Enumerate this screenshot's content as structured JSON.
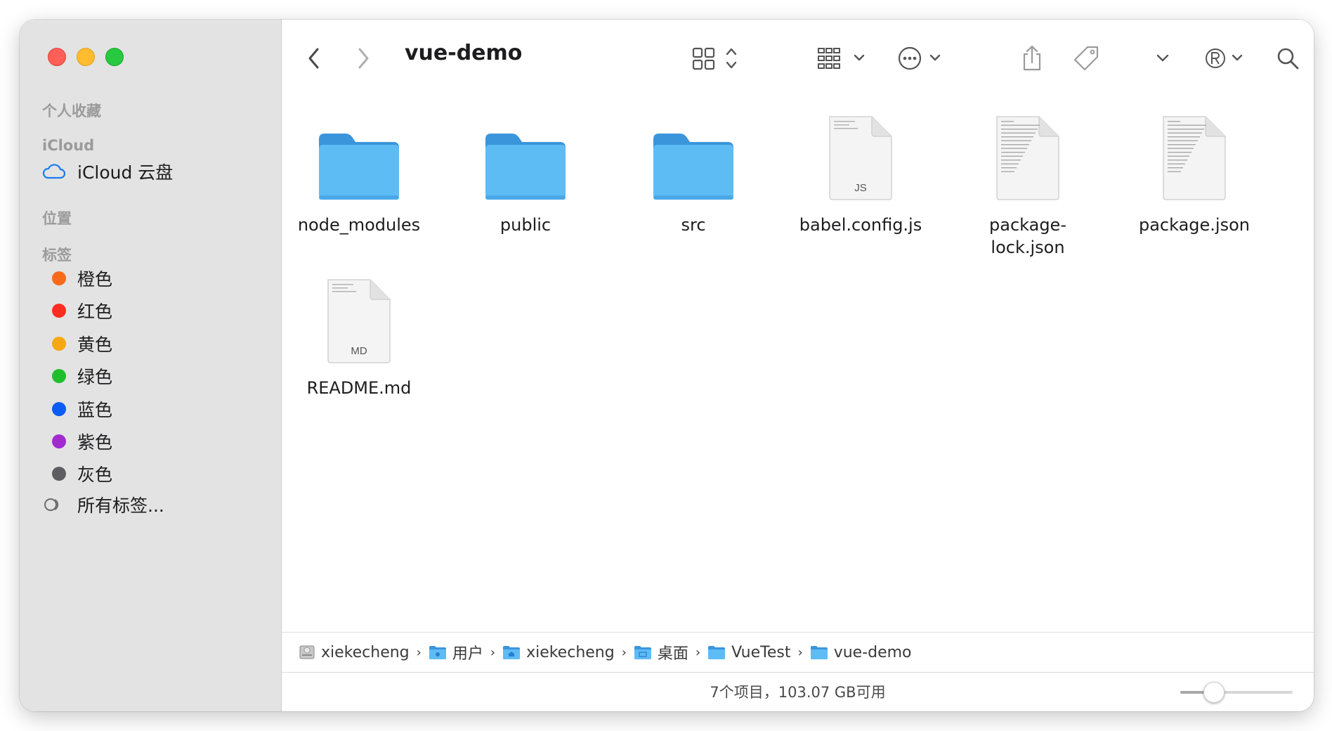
{
  "window": {
    "title": "vue-demo"
  },
  "sidebar": {
    "sections": {
      "favorites": "个人收藏",
      "icloud": "iCloud",
      "locations": "位置",
      "tags": "标签"
    },
    "icloud_drive": "iCloud 云盘",
    "tags": [
      {
        "label": "橙色",
        "color": "#f76a1a"
      },
      {
        "label": "红色",
        "color": "#ff2d20"
      },
      {
        "label": "黄色",
        "color": "#f6a811"
      },
      {
        "label": "绿色",
        "color": "#1fbe2c"
      },
      {
        "label": "蓝色",
        "color": "#0a5cf5"
      },
      {
        "label": "紫色",
        "color": "#a12ad1"
      },
      {
        "label": "灰色",
        "color": "#5e5e62"
      }
    ],
    "all_tags": "所有标签..."
  },
  "files": [
    {
      "name": "node_modules",
      "kind": "folder"
    },
    {
      "name": "public",
      "kind": "folder"
    },
    {
      "name": "src",
      "kind": "folder"
    },
    {
      "name": "babel.config.js",
      "kind": "document",
      "badge": "JS"
    },
    {
      "name": "package-lock.json",
      "name_line1": "package-",
      "name_line2": "lock.json",
      "kind": "document",
      "badge": ""
    },
    {
      "name": "package.json",
      "kind": "document",
      "badge": ""
    },
    {
      "name": "README.md",
      "kind": "document",
      "badge": "MD"
    }
  ],
  "pathbar": [
    {
      "label": "xiekecheng",
      "icon": "hard-drive-icon"
    },
    {
      "label": "用户",
      "icon": "users-folder-icon"
    },
    {
      "label": "xiekecheng",
      "icon": "home-folder-icon"
    },
    {
      "label": "桌面",
      "icon": "desktop-folder-icon"
    },
    {
      "label": "VueTest",
      "icon": "folder-icon"
    },
    {
      "label": "vue-demo",
      "icon": "folder-icon"
    }
  ],
  "status": {
    "text": "7个项目，103.07 GB可用",
    "icon_size_level": 0.25
  },
  "colors": {
    "folder_blue": "#5ebcf5",
    "folder_dark": "#3b95db",
    "accent": "#1d1d1f"
  }
}
